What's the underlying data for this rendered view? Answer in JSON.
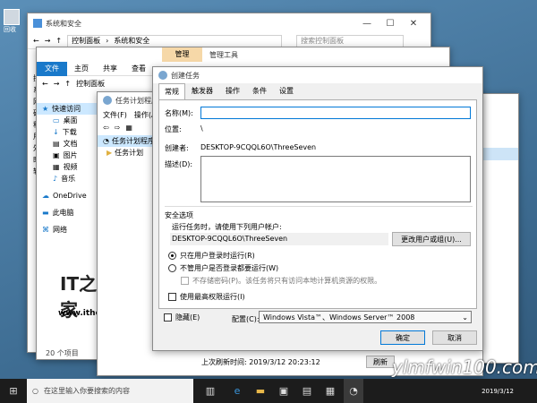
{
  "desktop": {
    "icon_label": "回收"
  },
  "win_control_panel": {
    "title": "系统和安全",
    "breadcrumb": [
      "控制面板",
      "系统和安全"
    ],
    "search_placeholder": "搜索控制面板",
    "left_letters": [
      "控",
      "系",
      "网",
      "硬",
      "程",
      "用",
      "外",
      "时",
      "轻"
    ]
  },
  "win_explorer": {
    "ribbon_tab_manage": "管理",
    "ribbon_tab_tools": "管理工具",
    "ribbon_tabs": [
      "文件",
      "主页",
      "共享",
      "查看"
    ],
    "breadcrumb": "控制面板",
    "nav": [
      {
        "label": "快速访问",
        "icon": "star-icon"
      },
      {
        "label": "桌面",
        "icon": "desktop-icon"
      },
      {
        "label": "下载",
        "icon": "download-icon"
      },
      {
        "label": "文档",
        "icon": "document-icon"
      },
      {
        "label": "图片",
        "icon": "picture-icon"
      },
      {
        "label": "视频",
        "icon": "video-icon"
      },
      {
        "label": "音乐",
        "icon": "music-icon"
      },
      {
        "label": "OneDrive",
        "icon": "cloud-icon"
      },
      {
        "label": "此电脑",
        "icon": "computer-icon"
      },
      {
        "label": "网络",
        "icon": "network-icon"
      }
    ],
    "status": "20 个项目",
    "brand_text": "IT之家",
    "url": "www.ithome.com"
  },
  "win_scheduler": {
    "title": "任务计划程序",
    "menu": [
      "文件(F)",
      "操作(A)"
    ],
    "tree": [
      "任务计划程序",
      "任务计划"
    ],
    "last_refresh": "上次刷新时间: 2019/3/12 20:23:12",
    "refresh_button": "刷新"
  },
  "dialog": {
    "title": "创建任务",
    "tabs": [
      "常规",
      "触发器",
      "操作",
      "条件",
      "设置"
    ],
    "name_label": "名称(M):",
    "name_value": "",
    "location_label": "位置:",
    "location_value": "\\",
    "author_label": "创建者:",
    "author_value": "DESKTOP-9CQQL6O\\ThreeSeven",
    "desc_label": "描述(D):",
    "security_title": "安全选项",
    "run_as_label": "运行任务时，请使用下列用户帐户:",
    "run_as_value": "DESKTOP-9CQQL6O\\ThreeSeven",
    "change_user_button": "更改用户或组(U)...",
    "radio_logged_on": "只在用户登录时运行(R)",
    "radio_whether": "不管用户是否登录都要运行(W)",
    "no_store_password": "不存储密码(P)。该任务将只有访问本地计算机资源的权限。",
    "highest_priv": "使用最高权限运行(I)",
    "hidden_label": "隐藏(E)",
    "config_label": "配置(C):",
    "config_value": "Windows Vista™、Windows Server™ 2008",
    "ok_button": "确定",
    "cancel_button": "取消"
  },
  "taskbar": {
    "search_placeholder": "在这里输入你要搜索的内容",
    "date": "2019/3/12"
  },
  "watermark": "ylmfwin100.com"
}
